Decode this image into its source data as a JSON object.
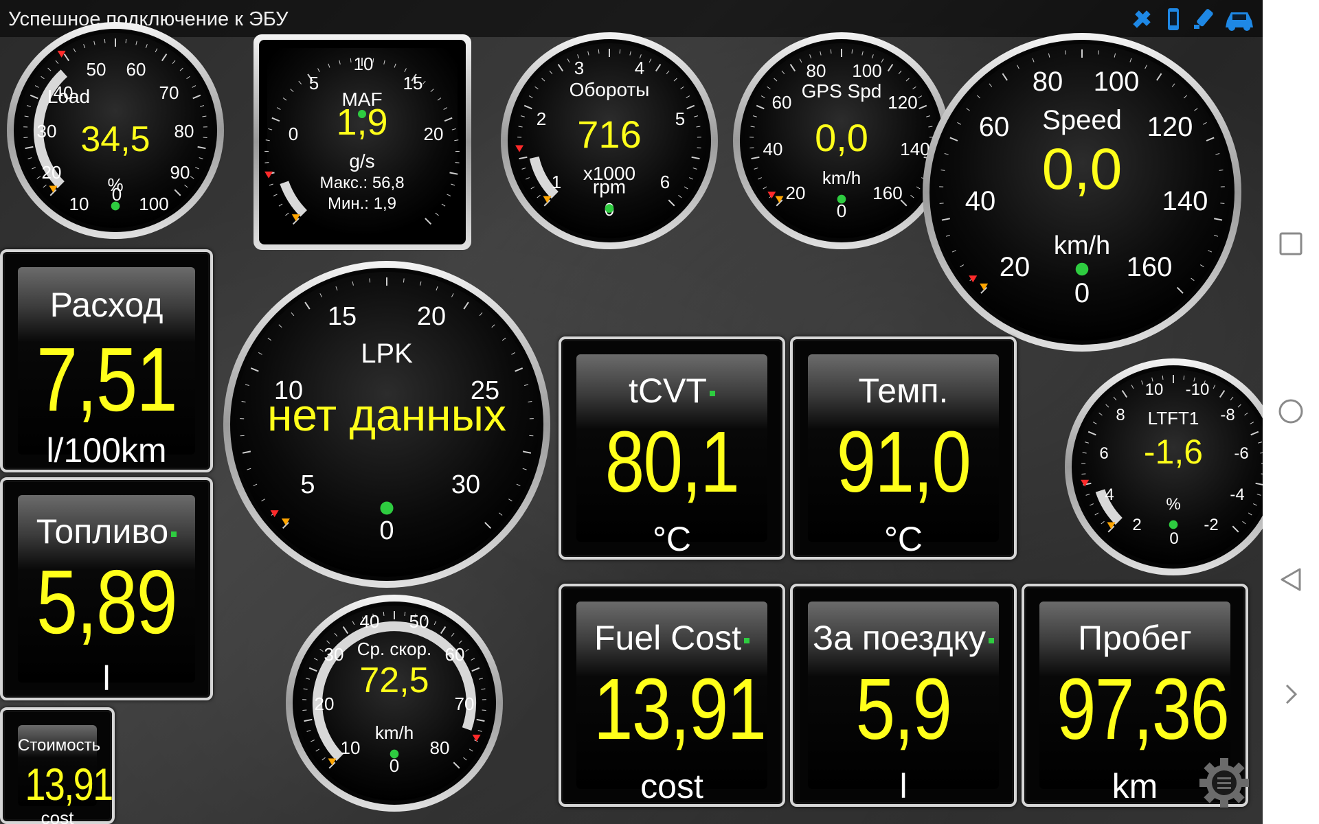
{
  "status": {
    "title": "Успешное подключение к ЭБУ",
    "icons": [
      "gps-icon",
      "phone-icon",
      "bluetooth-adapter-icon",
      "car-icon"
    ],
    "icon_color": "#1e88e5"
  },
  "colors": {
    "value": "#ffff1a",
    "text": "#ffffff",
    "pointer": "#ff2a2a",
    "min_marker": "#ffa500",
    "ok_dot": "#2ecc40"
  },
  "gauges": {
    "load": {
      "label": "Load",
      "value": "34,5",
      "unit": "%",
      "ticks": [
        "0",
        "10",
        "20",
        "30",
        "40",
        "50",
        "60",
        "70",
        "80",
        "90",
        "100"
      ],
      "fill": 0.345
    },
    "maf": {
      "label": "MAF",
      "value": "1,9",
      "unit": "g/s",
      "max_text": "Макс.: 56,8",
      "min_text": "Мин.: 1,9",
      "ticks": [
        "0",
        "5",
        "10",
        "15",
        "20"
      ],
      "fill": 0.095
    },
    "rpm": {
      "label": "Обороты",
      "value": "716",
      "unit1": "x1000",
      "unit2": "rpm",
      "ticks": [
        "0",
        "1",
        "2",
        "3",
        "4",
        "5",
        "6"
      ],
      "fill": 0.12
    },
    "gps": {
      "label": "GPS Spd",
      "value": "0,0",
      "unit": "km/h",
      "ticks": [
        "0",
        "20",
        "40",
        "60",
        "80",
        "100",
        "120",
        "140",
        "160"
      ],
      "fill": 0
    },
    "speed": {
      "label": "Speed",
      "value": "0,0",
      "unit": "km/h",
      "ticks": [
        "0",
        "20",
        "40",
        "60",
        "80",
        "100",
        "120",
        "140",
        "160"
      ],
      "fill": 0
    },
    "lpk": {
      "label": "LPK",
      "value": "нет данных",
      "ticks": [
        "0",
        "5",
        "10",
        "15",
        "20",
        "25",
        "30"
      ],
      "fill": 0
    },
    "ltft": {
      "label": "LTFT1",
      "value": "-1,6",
      "unit": "%",
      "ticks": [
        "0",
        "2",
        "4",
        "6",
        "8",
        "10",
        "-10",
        "-8",
        "-6",
        "-4",
        "-2"
      ],
      "fill": 0.1
    },
    "avgspeed": {
      "label": "Ср. скор.",
      "value": "72,5",
      "unit": "km/h",
      "ticks": [
        "0",
        "10",
        "20",
        "30",
        "40",
        "50",
        "60",
        "70",
        "80"
      ],
      "fill": 0.906
    }
  },
  "panels": {
    "consumption": {
      "title": "Расход",
      "value": "7,51",
      "unit": "l/100km"
    },
    "fuel": {
      "title": "Топливо",
      "value": "5,89",
      "unit": "l"
    },
    "cost_small": {
      "title": "Стоимость",
      "value": "13,91",
      "unit": "cost"
    },
    "tcvt": {
      "title": "tCVT",
      "value": "80,1",
      "unit": "°C"
    },
    "temp": {
      "title": "Темп.",
      "value": "91,0",
      "unit": "°C"
    },
    "fuelcost": {
      "title": "Fuel Cost",
      "value": "13,91",
      "unit": "cost"
    },
    "trip": {
      "title": "За поездку",
      "value": "5,9",
      "unit": "l"
    },
    "mileage": {
      "title": "Пробег",
      "value": "97,36",
      "unit": "km"
    }
  },
  "nav": {
    "buttons": [
      "recents-square-icon",
      "home-circle-icon",
      "back-triangle-icon",
      "forward-chevron-icon"
    ]
  }
}
